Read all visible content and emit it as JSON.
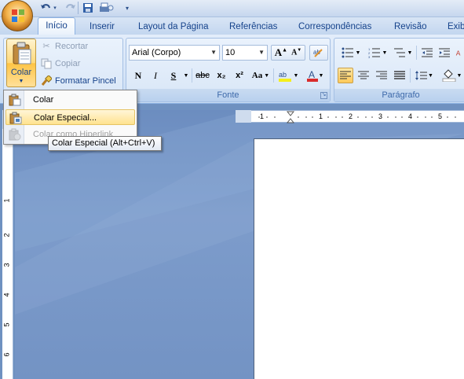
{
  "quick_access": {
    "undo_icon": "undo-icon",
    "redo_icon": "redo-icon",
    "save_icon": "save-icon",
    "print_icon": "print-icon"
  },
  "tabs": [
    {
      "label": "Início",
      "active": true
    },
    {
      "label": "Inserir"
    },
    {
      "label": "Layout da Página"
    },
    {
      "label": "Referências"
    },
    {
      "label": "Correspondências"
    },
    {
      "label": "Revisão"
    },
    {
      "label": "Exib"
    }
  ],
  "clipboard": {
    "paste_label": "Colar",
    "cut_label": "Recortar",
    "copy_label": "Copiar",
    "format_painter_label": "Formatar Pincel"
  },
  "font": {
    "family": "Arial (Corpo)",
    "size": "10",
    "group_label": "Fonte",
    "bold": "N",
    "italic": "I",
    "underline": "S",
    "strikethrough": "abc",
    "subscript": "x₂",
    "superscript": "x²",
    "change_case": "Aa",
    "grow": "A",
    "shrink": "A"
  },
  "paragraph": {
    "group_label": "Parágrafo"
  },
  "paste_menu": {
    "items": [
      {
        "label": "Colar",
        "state": "normal"
      },
      {
        "label": "Colar Especial...",
        "state": "highlighted"
      },
      {
        "label": "Colar como Hiperlink",
        "state": "disabled"
      }
    ]
  },
  "tooltip": {
    "text": "Colar Especial (Alt+Ctrl+V)"
  },
  "ruler": {
    "h_ticks": [
      "1",
      "1",
      "2",
      "3",
      "4",
      "5"
    ],
    "v_ticks": [
      "1",
      "2",
      "3",
      "4",
      "5",
      "6"
    ]
  },
  "colors": {
    "ribbon": "#d5e4f7",
    "highlight": "#ffe28f",
    "workspace": "#6f91c0"
  }
}
